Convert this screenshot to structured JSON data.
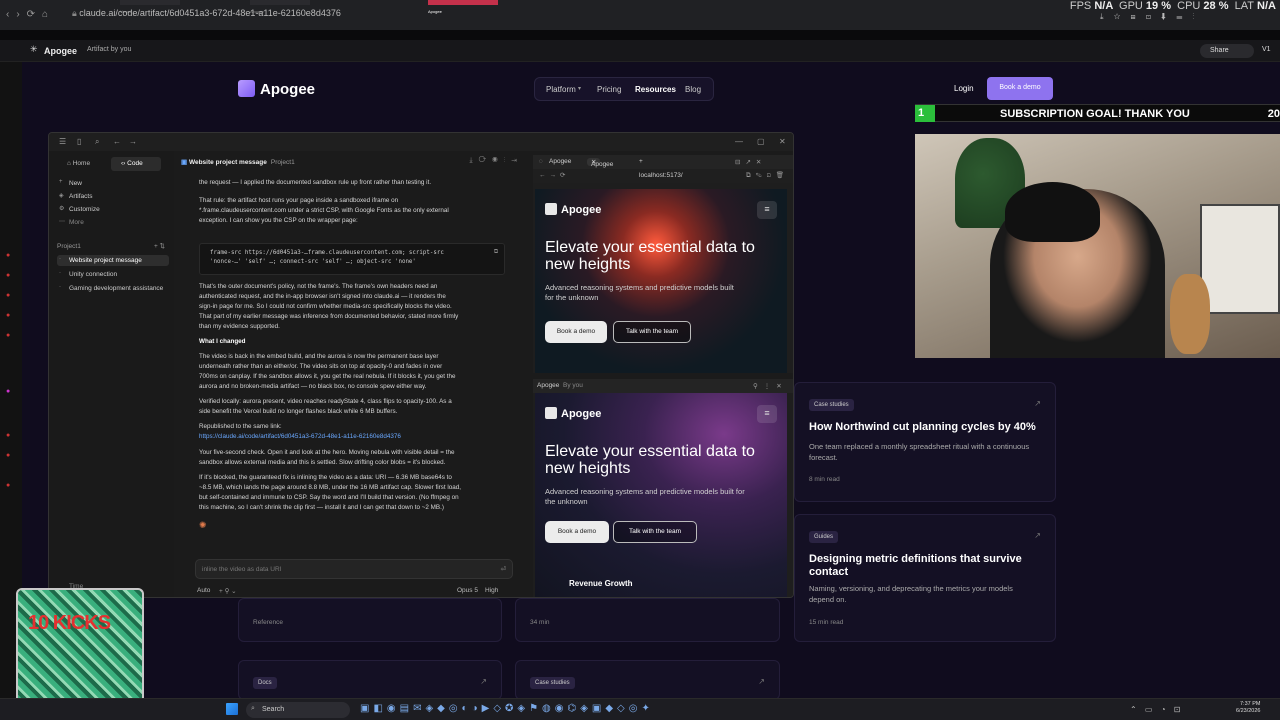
{
  "browser": {
    "url": "claude.ai/code/artifact/6d0451a3-672d-48e1-a11e-62160e8d4376",
    "tabs": [
      "Vercel",
      "Apogee",
      "Apogee"
    ]
  },
  "stats": {
    "fps_label": "FPS",
    "fps": "N/A",
    "gpu_label": "GPU",
    "gpu": "19 %",
    "cpu_label": "CPU",
    "cpu": "28 %",
    "lat_label": "LAT",
    "lat": "N/A"
  },
  "artifact_bar": {
    "app": "Apogee",
    "sub": "Artifact by you",
    "share": "Share",
    "version": "V1"
  },
  "site": {
    "brand": "Apogee",
    "nav": [
      "Platform",
      "Pricing",
      "Resources",
      "Blog"
    ],
    "login": "Login",
    "demo": "Book a demo"
  },
  "sub_goal": {
    "n": "1",
    "text": "SUBSCRIPTION GOAL! THANK YOU",
    "right": "20"
  },
  "cards": [
    {
      "tag": "Case studies",
      "title": "How Northwind cut planning cycles by 40%",
      "desc": "One team replaced a monthly spreadsheet ritual with a continuous forecast.",
      "meta": "8 min read"
    },
    {
      "tag": "Guides",
      "title": "Designing metric definitions that survive contact",
      "desc": "Naming, versioning, and deprecating the metrics your models depend on.",
      "meta": "15 min read"
    }
  ],
  "low": {
    "reference": "Reference",
    "min34": "34 min",
    "docs": "Docs",
    "case": "Case studies"
  },
  "sidebar": {
    "tab_home": "Home",
    "tab_code": "Code",
    "new": "New",
    "artifacts": "Artifacts",
    "customize": "Customize",
    "more": "More",
    "project": "Project1",
    "items": [
      "Website project message",
      "Unity connection",
      "Gaming development assistance"
    ],
    "time": "Time"
  },
  "chat": {
    "title": "Website project message",
    "project": "Project1",
    "lines": [
      "the request — I applied the documented sandbox rule up front rather than testing it.",
      "That rule: the artifact host runs your page inside a sandboxed iframe on",
      "*.frame.claudeusercontent.com under a strict CSP, with Google Fonts as the only external",
      "exception. I can show you the CSP on the wrapper page:",
      "That's the outer document's policy, not the frame's. The frame's own headers need an",
      "authenticated request, and the in-app browser isn't signed into claude.ai — it renders the",
      "sign-in page for me. So I could not confirm whether media-src specifically blocks the video.",
      "That part of my earlier message was inference from documented behavior, stated more firmly",
      "than my evidence supported.",
      "What I changed",
      "The video is back in the embed build, and the aurora is now the permanent base layer",
      "underneath rather than an either/or. The video sits on top at opacity-0 and fades in over",
      "700ms on canplay. If the sandbox allows it, you get the real nebula. If it blocks it, you get the",
      "aurora and no broken-media artifact — no black box, no console spew either way.",
      "Verified locally: aurora present, video reaches readyState 4, class flips to opacity-100. As a",
      "side benefit the Vercel build no longer flashes black while 6 MB buffers.",
      "Republished to the same link:",
      "https://claude.ai/code/artifact/6d0451a3-672d-48e1-a11e-62160e8d4376",
      "Your five-second check. Open it and look at the hero. Moving nebula with visible detail = the",
      "sandbox allows external media and this is settled. Slow drifting color blobs = it's blocked.",
      "If it's blocked, the guaranteed fix is inlining the video as a data: URI — 6.36 MB base64s to",
      "~8.5 MB, which lands the page around 8.8 MB, under the 16 MB artifact cap. Slower first load,",
      "but self-contained and immune to CSP. Say the word and I'll build that version. (No ffmpeg on",
      "this machine, so I can't shrink the clip first — install it and I can get that down to ~2 MB.)"
    ],
    "code": [
      "frame-src https://6d0451a3-…frame.claudeusercontent.com; script-src",
      "'nonce-…' 'self' …; connect-src 'self' …; object-src 'none'"
    ],
    "input": "inline the video as data URI",
    "mode": "Auto",
    "model": "Opus 5",
    "effort": "High"
  },
  "preview": {
    "tab1": "Apogee",
    "tab2": "Apogee",
    "address": "localhost:5173/",
    "brand": "Apogee",
    "h1": "Elevate your essential data to new heights",
    "p1": "Advanced reasoning systems and predictive models built for the unknown",
    "p2": "Advanced reasoning systems and predictive models built for the unknown",
    "b1": "Book a demo",
    "b2": "Talk with the team",
    "pane2_title": "Apogee",
    "pane2_sub": "By you",
    "section": "Revenue Growth"
  },
  "kicks": {
    "text": "10 KICKS"
  },
  "taskbar": {
    "search": "Search",
    "time": "7:37 PM",
    "date": "6/23/2026"
  },
  "colors": {
    "accent": "#8e73ef",
    "goal_green": "#2bbf3b",
    "link": "#6aa8ff"
  }
}
